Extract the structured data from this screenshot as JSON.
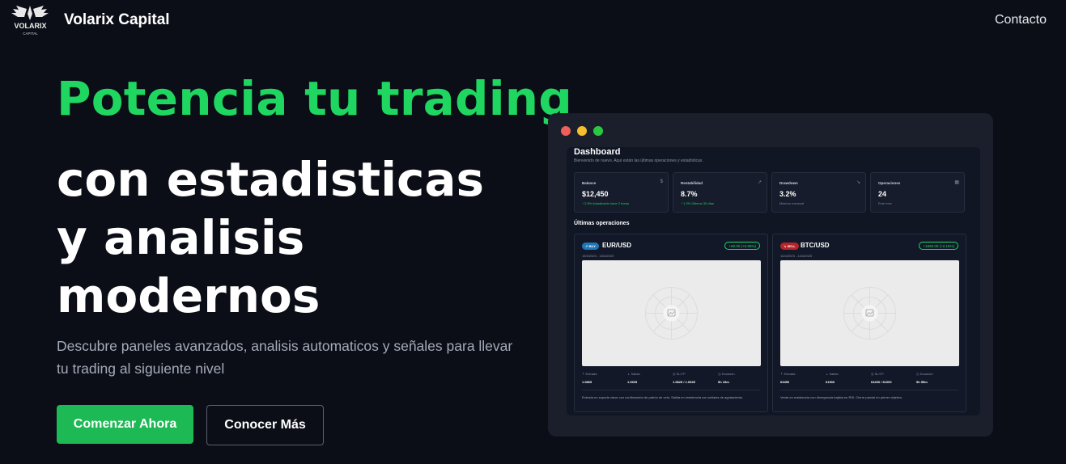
{
  "header": {
    "logo_text": "VOLARIX",
    "logo_subtext": "CAPITAL",
    "brand": "Volarix Capital",
    "nav_contact": "Contacto"
  },
  "hero": {
    "headline_green": "Potencia tu trading",
    "headline_white": [
      "con estadisticas",
      "y analisis",
      "modernos"
    ],
    "subtitle": "Descubre paneles avanzados, analisis automaticos y señales para llevar tu trading al siguiente nivel",
    "primary_button": "Comenzar Ahora",
    "secondary_button": "Conocer Más",
    "colors": {
      "accent": "#1fd760",
      "background": "#0b0e16"
    }
  },
  "dashboard": {
    "title": "Dashboard",
    "subtitle": "Bienvenido de nuevo. Aquí están las últimas operaciones y estadísticas.",
    "stats": [
      {
        "label": "Balance",
        "icon": "dollar-icon",
        "glyph": "$",
        "value": "$12,450",
        "note": "↑ 2.5% Actualizado hace 2 horas",
        "positive": true
      },
      {
        "label": "Rentabilidad",
        "icon": "trend-up-icon",
        "glyph": "↗",
        "value": "8.7%",
        "note": "↑ 1.2% Últimos 30 días",
        "positive": true
      },
      {
        "label": "Drawdown",
        "icon": "trend-down-icon",
        "glyph": "↘",
        "value": "3.2%",
        "note": "Máximo mensual",
        "positive": false
      },
      {
        "label": "Operaciones",
        "icon": "calendar-icon",
        "glyph": "▦",
        "value": "24",
        "note": "Este mes",
        "positive": false
      }
    ],
    "section_title": "Últimas operaciones",
    "trades": [
      {
        "type": "BUY",
        "type_glyph": "↗",
        "pair": "EUR/USD",
        "pnl": "+60.00 (+0.55%)",
        "dates": "15/4/2023 - 15/4/2023",
        "metrics": [
          {
            "key": "Entrada",
            "glyph": "⇡",
            "value": "1.0865"
          },
          {
            "key": "Salida",
            "glyph": "⇣",
            "value": "1.0925"
          },
          {
            "key": "SL/TP",
            "glyph": "◎",
            "value": "1.0825 / 1.0945"
          },
          {
            "key": "Duración",
            "glyph": "◷",
            "value": "5h 15m"
          }
        ],
        "note": "Entrada en soporte clave con confirmación de patrón de vela. Salida en resistencia con señales de agotamiento."
      },
      {
        "type": "SELL",
        "type_glyph": "↘",
        "pair": "BTC/USD",
        "pnl": "+1550.00 (+2.15%)",
        "dates": "14/4/2023 - 14/4/2023",
        "metrics": [
          {
            "key": "Entrada",
            "glyph": "⇡",
            "value": "63450"
          },
          {
            "key": "Salida",
            "glyph": "⇣",
            "value": "61900"
          },
          {
            "key": "SL/TP",
            "glyph": "◎",
            "value": "64200 / 61000"
          },
          {
            "key": "Duración",
            "glyph": "◷",
            "value": "5h 55m"
          }
        ],
        "note": "Venta en resistencia con divergencia bajista en RSI. Cierre parcial en primer objetivo."
      }
    ]
  }
}
